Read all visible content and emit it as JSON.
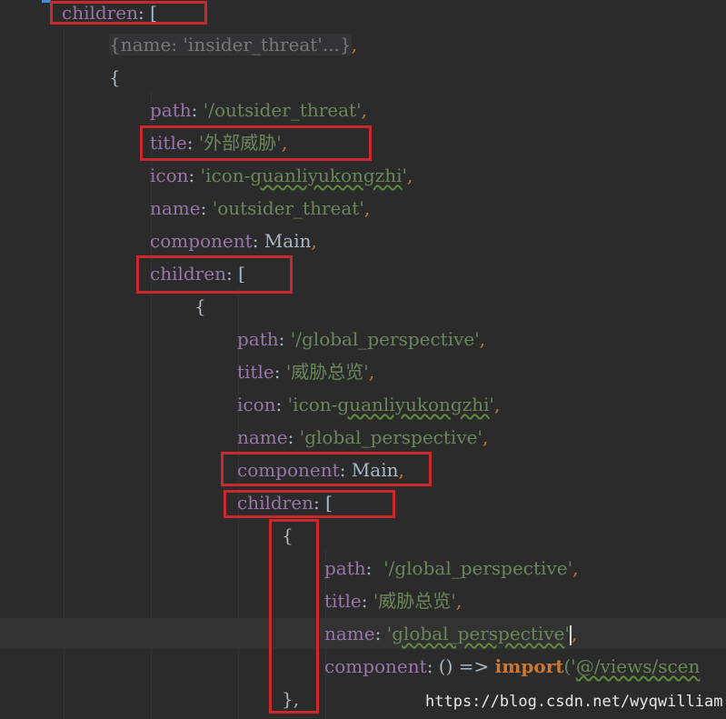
{
  "code_lines": [
    {
      "key": "children",
      "sep": ": ",
      "value": "[",
      "value_kind": "d"
    },
    {
      "fold": "{name: 'insider_threat'...}",
      "trail": ","
    },
    {
      "plain": "{"
    },
    {
      "key": "path",
      "sep": ": ",
      "value": "'/outsider_threat'",
      "value_kind": "s",
      "trail": ","
    },
    {
      "key": "title",
      "sep": ": ",
      "value": "'外部威胁'",
      "value_kind": "s",
      "trail": ","
    },
    {
      "key": "icon",
      "sep": ": ",
      "value_pre": "'icon-",
      "value_squig": "guanliyukongzhi",
      "value_post": "'",
      "value_kind": "s",
      "trail": ","
    },
    {
      "key": "name",
      "sep": ": ",
      "value": "'outsider_threat'",
      "value_kind": "s",
      "trail": ","
    },
    {
      "key": "component",
      "sep": ": ",
      "value": "Main",
      "value_kind": "d",
      "trail": ","
    },
    {
      "key": "children",
      "sep": ": ",
      "value": "[",
      "value_kind": "d"
    },
    {
      "plain": "{"
    },
    {
      "key": "path",
      "sep": ": ",
      "value": "'/global_perspective'",
      "value_kind": "s",
      "trail": ","
    },
    {
      "key": "title",
      "sep": ": ",
      "value": "'威胁总览'",
      "value_kind": "s",
      "trail": ","
    },
    {
      "key": "icon",
      "sep": ": ",
      "value_pre": "'icon-",
      "value_squig": "guanliyukongzhi",
      "value_post": "'",
      "value_kind": "s",
      "trail": ","
    },
    {
      "key": "name",
      "sep": ": ",
      "value": "'global_perspective'",
      "value_kind": "s",
      "trail": ","
    },
    {
      "key": "component",
      "sep": ": ",
      "value": "Main",
      "value_kind": "d",
      "trail": ","
    },
    {
      "key": "children",
      "sep": ": ",
      "value": "[",
      "value_kind": "d"
    },
    {
      "plain": "{"
    },
    {
      "key": "path",
      "sep": ":  ",
      "value": "'/global_perspective'",
      "value_kind": "s",
      "trail": ","
    },
    {
      "key": "title",
      "sep": ": ",
      "value": "'威胁总览'",
      "value_kind": "s",
      "trail": ","
    },
    {
      "key": "name",
      "sep": ": ",
      "value_pre": "'",
      "value_squig": "global_perspective",
      "value_post": "'",
      "value_kind": "s",
      "trail": ",",
      "caret": true
    },
    {
      "key": "component",
      "sep": ": ",
      "arrow": "() => ",
      "kw": "import",
      "value_pre": "('",
      "value_squig": "@/views/scen",
      "value_kind": "s"
    },
    {
      "plain": "},"
    }
  ],
  "watermark": "https://blog.csdn.net/wyqwilliam",
  "colors": {
    "background": "#2b2b2b",
    "key": "#9876aa",
    "string": "#6a8759",
    "punctuation": "#cc7832",
    "default": "#a9b7c6",
    "highlight_box": "#c9282d"
  }
}
